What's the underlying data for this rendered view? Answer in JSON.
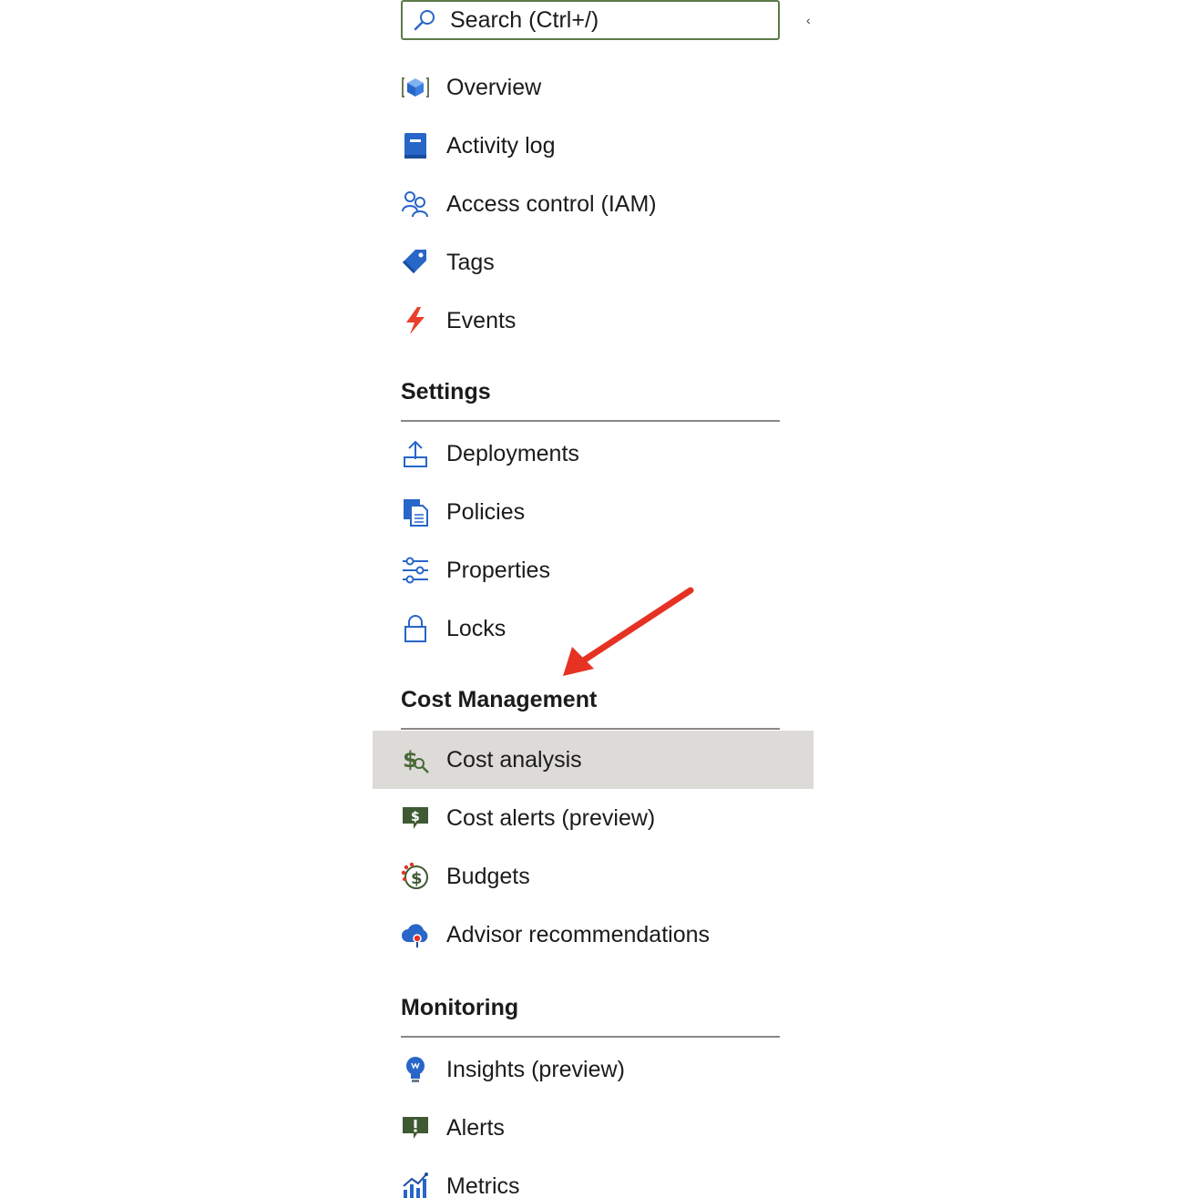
{
  "search": {
    "placeholder": "Search (Ctrl+/)"
  },
  "collapse_glyph": "‹",
  "top_items": [
    {
      "label": "Overview",
      "icon": "overview-cube-icon"
    },
    {
      "label": "Activity log",
      "icon": "activity-log-book-icon"
    },
    {
      "label": "Access control (IAM)",
      "icon": "people-icon"
    },
    {
      "label": "Tags",
      "icon": "tag-icon"
    },
    {
      "label": "Events",
      "icon": "lightning-bolt-icon"
    }
  ],
  "sections": [
    {
      "title": "Settings",
      "items": [
        {
          "label": "Deployments",
          "icon": "upload-icon"
        },
        {
          "label": "Policies",
          "icon": "policy-document-icon"
        },
        {
          "label": "Properties",
          "icon": "sliders-icon"
        },
        {
          "label": "Locks",
          "icon": "lock-icon"
        }
      ]
    },
    {
      "title": "Cost Management",
      "items": [
        {
          "label": "Cost analysis",
          "icon": "cost-analysis-icon",
          "selected": true
        },
        {
          "label": "Cost alerts (preview)",
          "icon": "cost-alert-icon"
        },
        {
          "label": "Budgets",
          "icon": "budget-icon"
        },
        {
          "label": "Advisor recommendations",
          "icon": "advisor-cloud-icon"
        }
      ]
    },
    {
      "title": "Monitoring",
      "items": [
        {
          "label": "Insights (preview)",
          "icon": "lightbulb-icon"
        },
        {
          "label": "Alerts",
          "icon": "alert-icon"
        },
        {
          "label": "Metrics",
          "icon": "metrics-chart-icon"
        }
      ]
    }
  ],
  "colors": {
    "accent_blue": "#2866c8",
    "selected_bg": "#dddbd7",
    "arrow_red": "#e63222",
    "search_border": "#5b7a4a"
  }
}
